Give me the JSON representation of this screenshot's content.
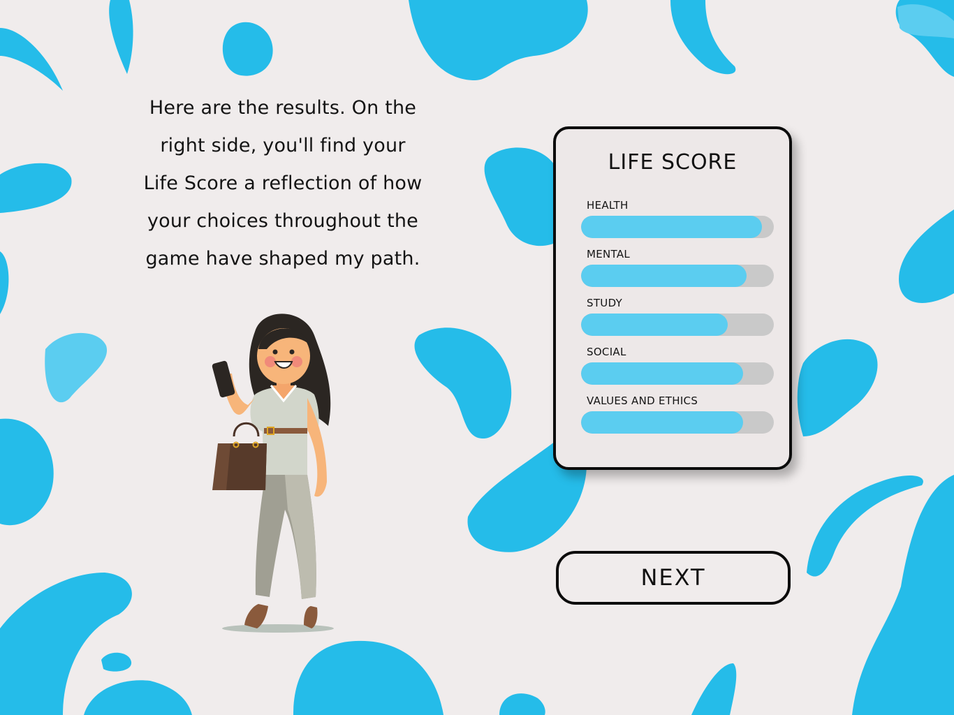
{
  "intro": {
    "lines": [
      "Here are the results. On the",
      "right side, you'll find your",
      "Life Score a reflection of how",
      "your choices throughout the",
      "game have shaped my path."
    ]
  },
  "life_score": {
    "title": "LIFE SCORE",
    "stats": [
      {
        "label": "HEALTH",
        "fraction": 0.94
      },
      {
        "label": "MENTAL",
        "fraction": 0.86
      },
      {
        "label": "STUDY",
        "fraction": 0.76
      },
      {
        "label": "SOCIAL",
        "fraction": 0.84
      },
      {
        "label": "VALUES AND ETHICS",
        "fraction": 0.84
      }
    ]
  },
  "next_button": {
    "label": "NEXT"
  },
  "colors": {
    "background": "#F0ECEC",
    "blob_primary": "#25BCE9",
    "blob_light": "#5BCDF0",
    "bar_fill": "#5BCDF0",
    "bar_track": "#C9C9C9",
    "outline": "#0C0C0C"
  }
}
